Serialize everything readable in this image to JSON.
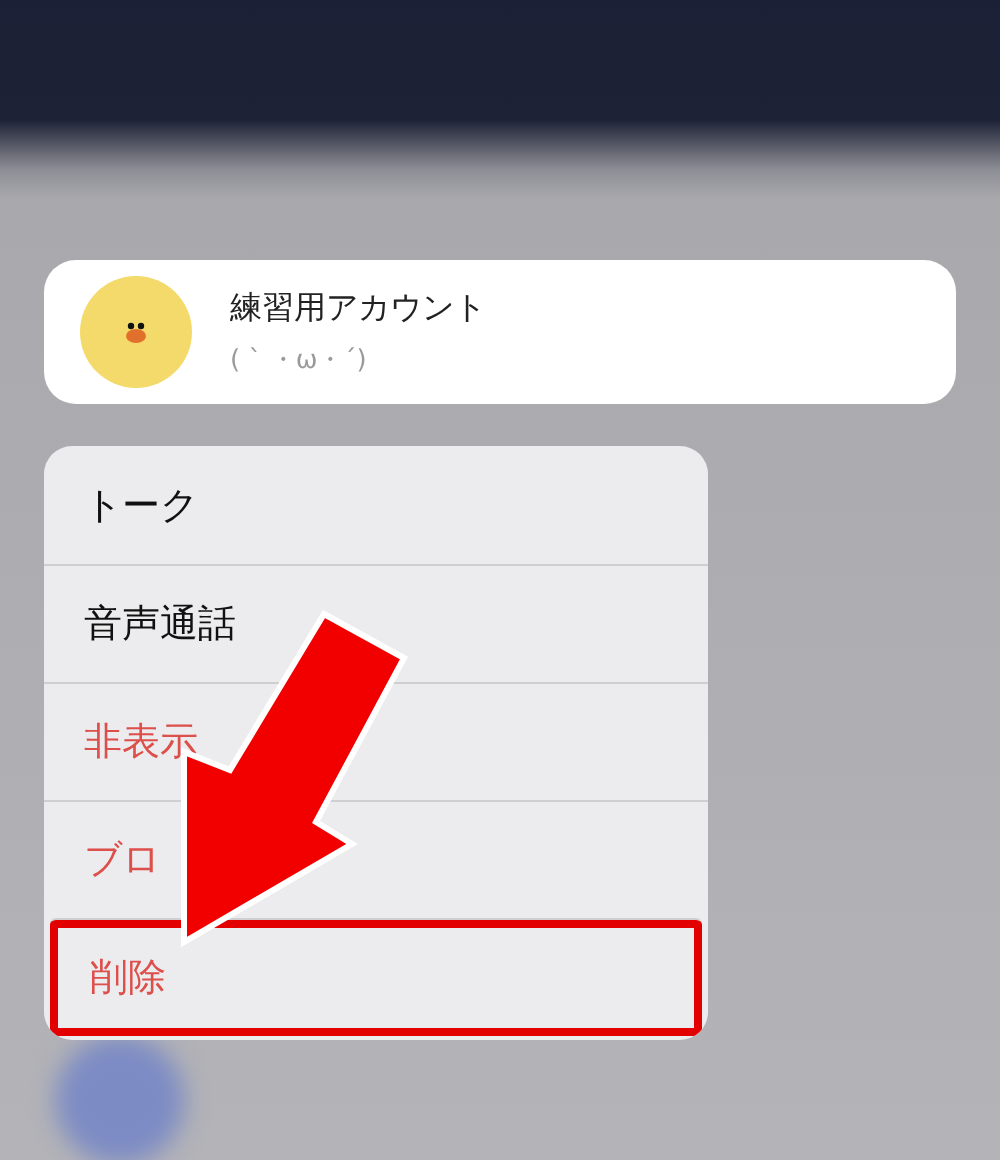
{
  "profile": {
    "name": "練習用アカウント",
    "status": "( ` ・ω・´)"
  },
  "menu": {
    "items": [
      {
        "label": "トーク",
        "kind": "normal",
        "annotated": false
      },
      {
        "label": "音声通話",
        "kind": "normal",
        "annotated": false
      },
      {
        "label": "非表示",
        "kind": "destructive",
        "annotated": false
      },
      {
        "label": "ブロ",
        "kind": "destructive",
        "annotated": false
      },
      {
        "label": "削除",
        "kind": "destructive",
        "annotated": true
      }
    ]
  }
}
